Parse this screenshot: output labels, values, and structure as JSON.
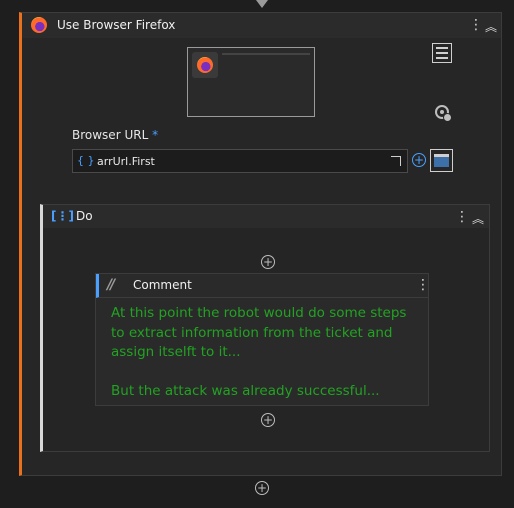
{
  "activity": {
    "title": "Use Browser Firefox",
    "icon": "firefox-icon",
    "accent_color": "#e9711c"
  },
  "browser_url": {
    "label": "Browser URL",
    "required_marker": "*",
    "value": "arrUrl.First",
    "prefix_icon": "expression-braces-icon"
  },
  "sequence": {
    "title": "Do",
    "icon": "sequence-icon"
  },
  "comment": {
    "title": "Comment",
    "lines": [
      "At this point the robot would do some steps to extract information from the ticket and assign itselft to it...",
      "",
      "But the attack was already successful..."
    ],
    "text_color": "#22a322"
  }
}
